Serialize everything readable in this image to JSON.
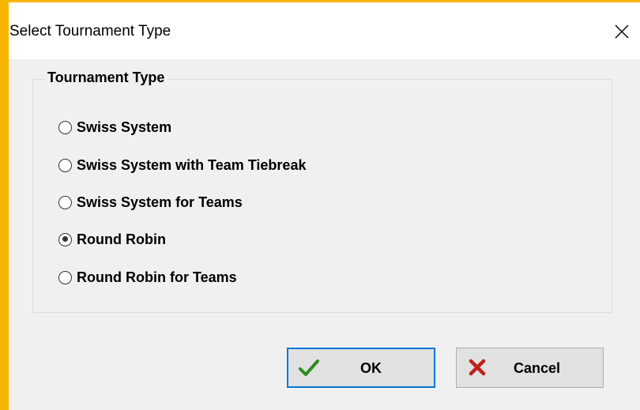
{
  "dialog": {
    "title": "Select Tournament Type",
    "close_icon": "close-icon"
  },
  "group": {
    "legend": "Tournament Type",
    "options": [
      {
        "label": "Swiss System",
        "checked": false
      },
      {
        "label": "Swiss System with Team Tiebreak",
        "checked": false
      },
      {
        "label": "Swiss System for Teams",
        "checked": false
      },
      {
        "label": "Round Robin",
        "checked": true
      },
      {
        "label": "Round Robin for Teams",
        "checked": false
      }
    ]
  },
  "buttons": {
    "ok_label": "OK",
    "ok_icon": "checkmark-icon",
    "cancel_label": "Cancel",
    "cancel_icon": "red-x-icon"
  },
  "colors": {
    "window_background": "#f7b500",
    "dialog_background": "#f0f0f0",
    "default_button_border": "#0078d7",
    "ok_check": "#2e8b1f",
    "cancel_x": "#c0201a"
  }
}
